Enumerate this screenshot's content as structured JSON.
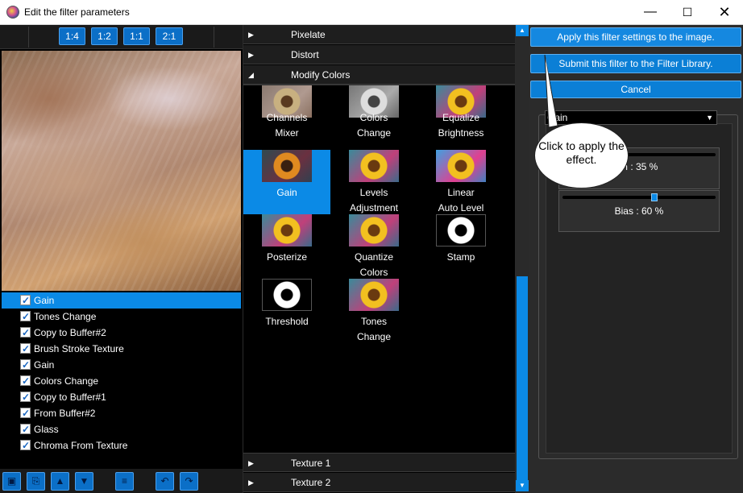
{
  "window": {
    "title": "Edit the filter parameters",
    "minimize": "—",
    "maximize": "☐",
    "close": "✕"
  },
  "zoom": {
    "buttons": [
      "1:4",
      "1:2",
      "1:1",
      "2:1"
    ]
  },
  "filter_stack": {
    "items": [
      {
        "label": "Gain",
        "checked": true,
        "selected": true
      },
      {
        "label": "Tones Change",
        "checked": true
      },
      {
        "label": "Copy to Buffer#2",
        "checked": true
      },
      {
        "label": "Brush Stroke Texture",
        "checked": true
      },
      {
        "label": "Gain",
        "checked": true
      },
      {
        "label": "Colors Change",
        "checked": true
      },
      {
        "label": "Copy to Buffer#1",
        "checked": true
      },
      {
        "label": "From Buffer#2",
        "checked": true
      },
      {
        "label": "Glass",
        "checked": true
      },
      {
        "label": "Chroma From Texture",
        "checked": true
      }
    ]
  },
  "bottom_toolbar": {
    "icons": [
      "new-icon",
      "paste-icon",
      "move-up-icon",
      "move-down-icon",
      "menu-icon",
      "undo-icon",
      "redo-icon"
    ],
    "glyphs": [
      "▣",
      "⎘",
      "▲",
      "▼",
      "≡",
      "↶",
      "↷"
    ]
  },
  "categories": {
    "top": [
      {
        "label": "Pixelate",
        "expanded": false,
        "arrow": "▶"
      },
      {
        "label": "Distort",
        "expanded": false,
        "arrow": "▶"
      },
      {
        "label": "Modify Colors",
        "expanded": true,
        "arrow": "◢"
      }
    ],
    "bottom": [
      {
        "label": "Texture 1",
        "expanded": false,
        "arrow": "▶"
      },
      {
        "label": "Texture 2",
        "expanded": false,
        "arrow": "▶"
      }
    ]
  },
  "filters": [
    {
      "label": "Channels\nMixer",
      "thumb": "sun-warm"
    },
    {
      "label": "Colors\nChange",
      "thumb": "sun-gray"
    },
    {
      "label": "Equalize\nBrightness",
      "thumb": "sun"
    },
    {
      "label": "Gain",
      "thumb": "sun-dark",
      "selected": true
    },
    {
      "label": "Levels\nAdjustment",
      "thumb": "sun"
    },
    {
      "label": "Linear\nAuto Level",
      "thumb": "sun-blue"
    },
    {
      "label": "Posterize",
      "thumb": "sun"
    },
    {
      "label": "Quantize\nColors",
      "thumb": "sun"
    },
    {
      "label": "Stamp",
      "thumb": "sun-bw"
    },
    {
      "label": "Threshold",
      "thumb": "sun-bw"
    },
    {
      "label": "Tones\nChange",
      "thumb": "sun"
    }
  ],
  "scrollbar": {
    "up": "▲",
    "down": "▼"
  },
  "actions": {
    "apply": "Apply this filter settings to the image.",
    "submit": "Submit this filter to the Filter Library.",
    "cancel": "Cancel"
  },
  "params": {
    "preset": "Gain",
    "preset_arrow": "▼",
    "sliders": [
      {
        "label": "Gain : 35 %",
        "visible_label": "in : 35 %",
        "value": 35
      },
      {
        "label": "Bias : 60 %",
        "visible_label": "Bias : 60 %",
        "value": 60
      }
    ]
  },
  "callout": {
    "text": "Click to apply the effect."
  },
  "colors": {
    "accent": "#0b8ae6",
    "button": "#0b7fd6",
    "background": "#000000",
    "panel": "#2b2b2b"
  }
}
